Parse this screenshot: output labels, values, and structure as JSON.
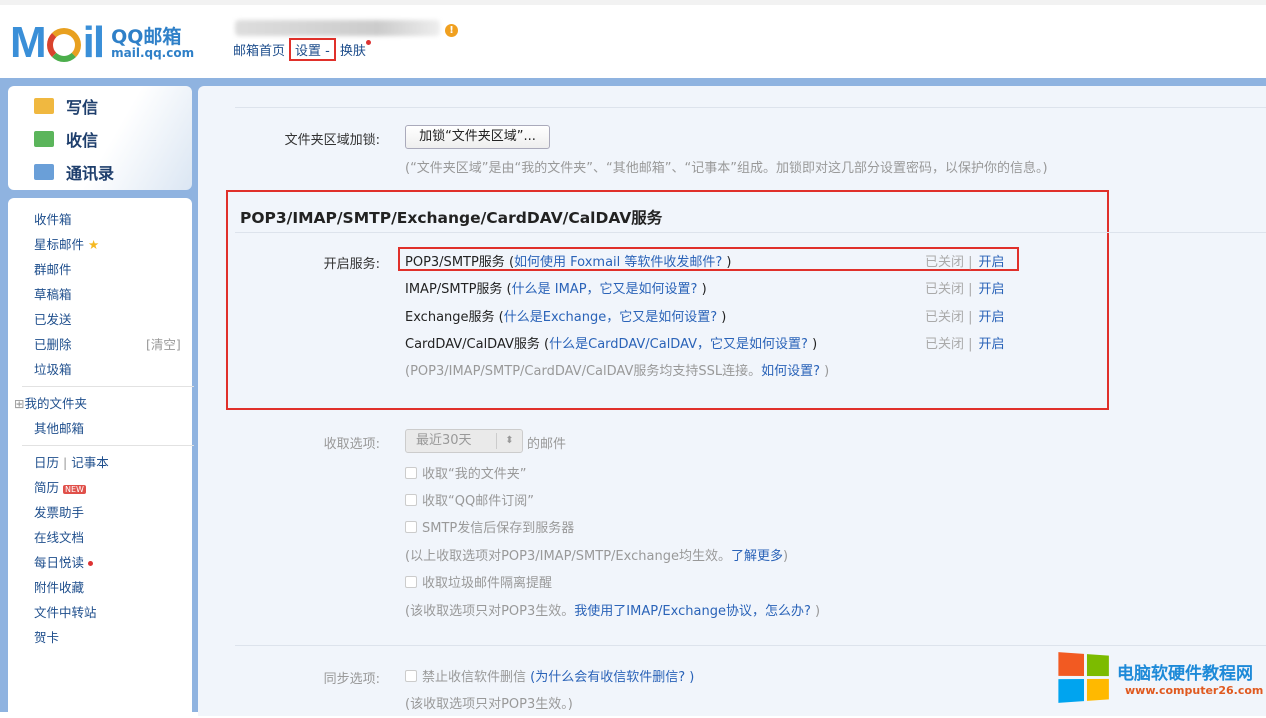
{
  "header": {
    "logo_text": "MOil",
    "logo_cn": "QQ邮箱",
    "logo_domain": "mail.qq.com",
    "nav": [
      "邮箱首页",
      "设置",
      "-",
      "换肤"
    ]
  },
  "sidebar": {
    "actions": [
      "写信",
      "收信",
      "通讯录"
    ],
    "folders": [
      "收件箱",
      "星标邮件",
      "群邮件",
      "草稿箱",
      "已发送",
      "已删除",
      "垃圾箱"
    ],
    "clear_label": "[清空]",
    "my_folders": "我的文件夹",
    "other": "其他邮箱",
    "calendar": "日历",
    "notes": "记事本",
    "new_badge": "NEW",
    "apps": [
      "简历",
      "发票助手",
      "在线文档",
      "每日悦读",
      "附件收藏",
      "文件中转站",
      "贺卡"
    ]
  },
  "main": {
    "lock_label": "文件夹区域加锁:",
    "lock_button": "加锁“文件夹区域”...",
    "lock_note": "(“文件夹区域”是由“我的文件夹”、“其他邮箱”、“记事本”组成。加锁即对这几部分设置密码，以保护你的信息。)",
    "section_title": "POP3/IMAP/SMTP/Exchange/CardDAV/CalDAV服务",
    "service_label": "开启服务:",
    "services": [
      {
        "name": "POP3/SMTP服务 (",
        "link": "如何使用 Foxmail 等软件收发邮件?",
        "close": " )",
        "status": "已关闭",
        "action": "开启"
      },
      {
        "name": "IMAP/SMTP服务 (",
        "link": "什么是 IMAP，它又是如何设置?",
        "close": " )",
        "status": "已关闭",
        "action": "开启"
      },
      {
        "name": "Exchange服务 (",
        "link": "什么是Exchange，它又是如何设置?",
        "close": " )",
        "status": "已关闭",
        "action": "开启"
      },
      {
        "name": "CardDAV/CalDAV服务 (",
        "link": "什么是CardDAV/CalDAV，它又是如何设置?",
        "close": " )",
        "status": "已关闭",
        "action": "开启"
      }
    ],
    "ssl_note": "(POP3/IMAP/SMTP/CardDAV/CalDAV服务均支持SSL连接。",
    "ssl_link": "如何设置?",
    "ssl_close": " )",
    "fetch_label": "收取选项:",
    "fetch_select": "最近30天",
    "fetch_suffix": "的邮件",
    "fetch_opts": [
      "收取“我的文件夹”",
      "收取“QQ邮件订阅”",
      "SMTP发信后保存到服务器"
    ],
    "fetch_note": "(以上收取选项对POP3/IMAP/SMTP/Exchange均生效。",
    "fetch_note_link": "了解更多",
    "fetch_note_close": ")",
    "spam_opt": "收取垃圾邮件隔离提醒",
    "spam_note": "(该收取选项只对POP3生效。",
    "spam_note_link": "我使用了IMAP/Exchange协议，怎么办?",
    "spam_note_close": " )",
    "sync_label": "同步选项:",
    "sync_opt": "禁止收信软件删信",
    "sync_link": "(为什么会有收信软件删信? )",
    "sync_note": "(该收取选项只对POP3生效。)"
  },
  "watermark": {
    "title": "电脑软硬件教程网",
    "url": "www.computer26.com"
  }
}
